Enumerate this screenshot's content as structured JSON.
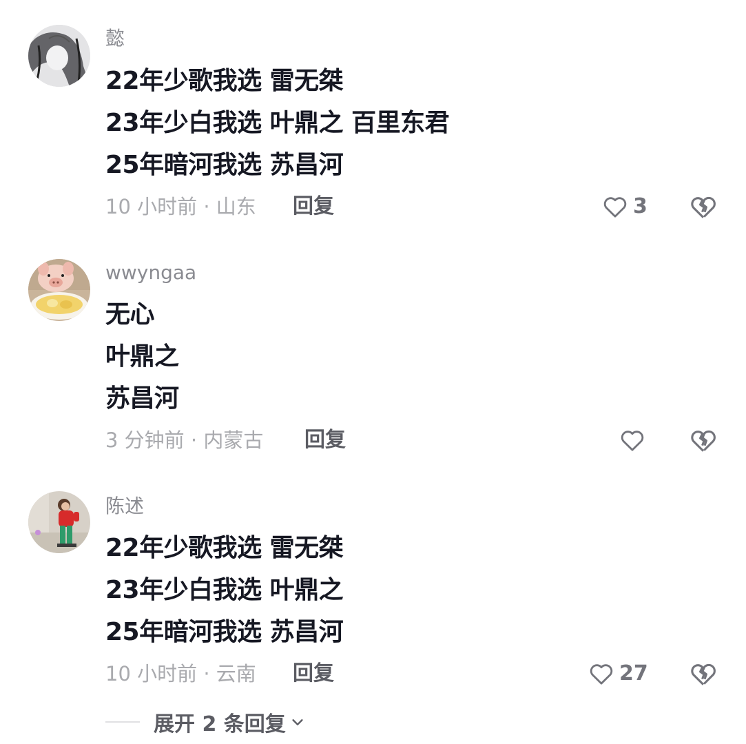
{
  "comments": [
    {
      "username": "懿",
      "lines": [
        "22年少歌我选 雷无桀",
        "23年少白我选 叶鼎之 百里东君",
        "25年暗河我选 苏昌河"
      ],
      "time_location": "10 小时前 · 山东",
      "reply_label": "回复",
      "like_count": "3"
    },
    {
      "username": "wwyngaa",
      "lines": [
        "无心",
        "叶鼎之",
        "苏昌河"
      ],
      "time_location": "3 分钟前 · 内蒙古",
      "reply_label": "回复",
      "like_count": ""
    },
    {
      "username": "陈述",
      "lines": [
        "22年少歌我选 雷无桀",
        "23年少白我选 叶鼎之",
        "25年暗河我选 苏昌河"
      ],
      "time_location": "10 小时前 · 云南",
      "reply_label": "回复",
      "like_count": "27"
    }
  ],
  "expand": {
    "label": "展开 2 条回复"
  },
  "icons": {
    "like": "heart-outline-icon",
    "dislike": "broken-heart-icon",
    "expand": "chevron-down-icon"
  },
  "colors": {
    "primary_text": "#161823",
    "secondary_text": "#a9aaae",
    "icon": "#73747b"
  }
}
